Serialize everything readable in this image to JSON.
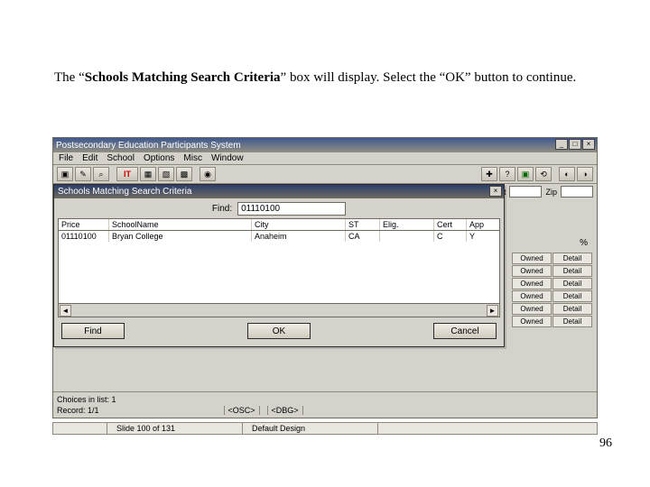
{
  "instruction": {
    "part1": "The “",
    "bold": "Schools Matching Search Criteria",
    "part2": "” box will display.  Select the “OK” button to continue."
  },
  "page_number": "96",
  "main_window": {
    "title": "Postsecondary Education Participants System",
    "menus": [
      "File",
      "Edit",
      "School",
      "Options",
      "Misc",
      "Window"
    ],
    "bg_labels": {
      "st": "St",
      "zip": "Zip"
    },
    "pct": "%",
    "owned_label": "Owned",
    "detail_label": "Detail"
  },
  "dialog": {
    "title": "Schools Matching Search Criteria",
    "find_label": "Find:",
    "find_value": "01110100",
    "columns": {
      "price": "Price",
      "name": "SchoolName",
      "city": "City",
      "st": "ST",
      "elig": "Elig.",
      "cert": "Cert",
      "app": "App"
    },
    "row": {
      "price": "01110100",
      "name": "Bryan College",
      "city": "Anaheim",
      "st": "CA",
      "elig": " ",
      "cert": "C",
      "app": "Y"
    },
    "btn_find": "Find",
    "btn_ok": "OK",
    "btn_cancel": "Cancel"
  },
  "footer": {
    "choice": "Choices in list: 1",
    "record": "Record: 1/1",
    "osc": "<OSC>",
    "dbg": "<DBG>"
  },
  "statusbar": {
    "slide": "Slide 100 of 131",
    "design": "Default Design"
  }
}
